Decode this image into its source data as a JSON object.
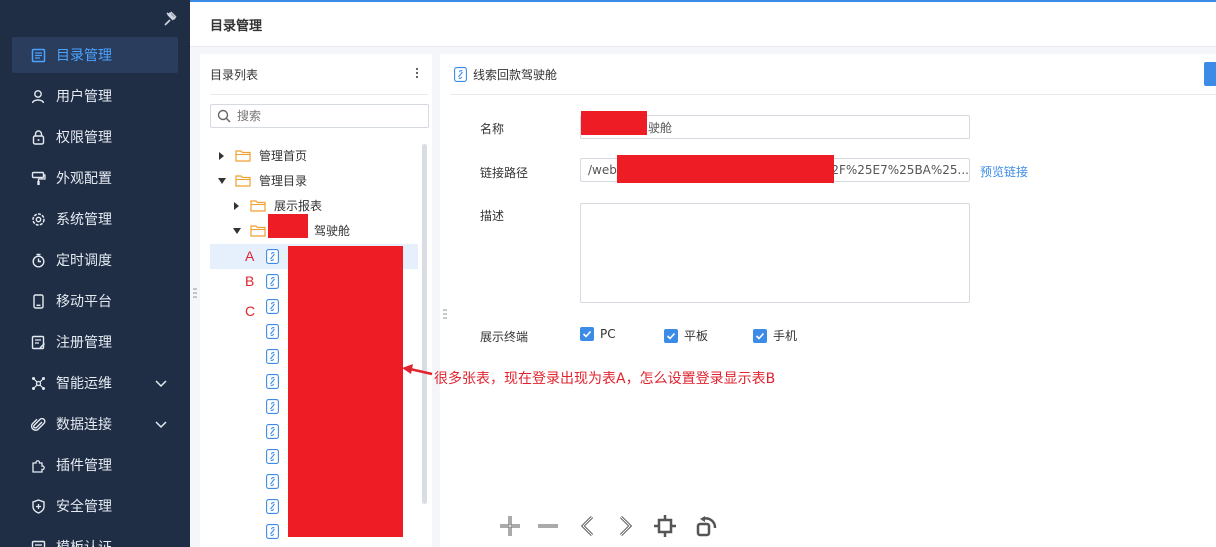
{
  "sidebar": {
    "items": [
      {
        "label": "目录管理",
        "icon": "catalog-icon"
      },
      {
        "label": "用户管理",
        "icon": "user-icon"
      },
      {
        "label": "权限管理",
        "icon": "lock-icon"
      },
      {
        "label": "外观配置",
        "icon": "paint-brush-icon"
      },
      {
        "label": "系统管理",
        "icon": "gear-icon"
      },
      {
        "label": "定时调度",
        "icon": "timer-icon"
      },
      {
        "label": "移动平台",
        "icon": "mobile-icon"
      },
      {
        "label": "注册管理",
        "icon": "register-icon"
      },
      {
        "label": "智能运维",
        "icon": "network-icon"
      },
      {
        "label": "数据连接",
        "icon": "paperclip-icon"
      },
      {
        "label": "插件管理",
        "icon": "puzzle-icon"
      },
      {
        "label": "安全管理",
        "icon": "shield-icon"
      },
      {
        "label": "模板认证",
        "icon": "template-icon"
      }
    ],
    "active_index": 0
  },
  "header": {
    "title": "目录管理"
  },
  "directory": {
    "title": "目录列表",
    "search_placeholder": "搜索",
    "tree": [
      {
        "label": "管理首页",
        "level": 0,
        "expanded": false
      },
      {
        "label": "管理目录",
        "level": 0,
        "expanded": true
      },
      {
        "label": "展示报表",
        "level": 1,
        "expanded": false
      },
      {
        "label": "驾驶舱",
        "level": 1,
        "expanded": true
      }
    ],
    "markers": [
      "A",
      "B",
      "C"
    ]
  },
  "detail": {
    "header_title": "线索回款驾驶舱",
    "name_label": "名称",
    "name_value": "驶舱",
    "path_label": "链接路径",
    "path_value_start": "/webr",
    "path_value_end": "2F%25E7%25BA%25...",
    "preview_link": "预览链接",
    "desc_label": "描述",
    "terminal_label": "展示终端",
    "terminals": [
      {
        "label": "PC",
        "checked": true
      },
      {
        "label": "平板",
        "checked": true
      },
      {
        "label": "手机",
        "checked": true
      }
    ]
  },
  "annotation": {
    "text": "很多张表，现在登录出现为表A，怎么设置登录显示表B"
  },
  "toolbar": {
    "icons": [
      "zoom-in-icon",
      "zoom-out-icon",
      "prev-icon",
      "next-icon",
      "fit-screen-icon",
      "rotate-icon"
    ]
  },
  "colors": {
    "accent": "#3c8ce7",
    "sidebar_bg": "#1f2d45",
    "annotation_red": "#e0242f",
    "redaction": "#ee1c25"
  }
}
